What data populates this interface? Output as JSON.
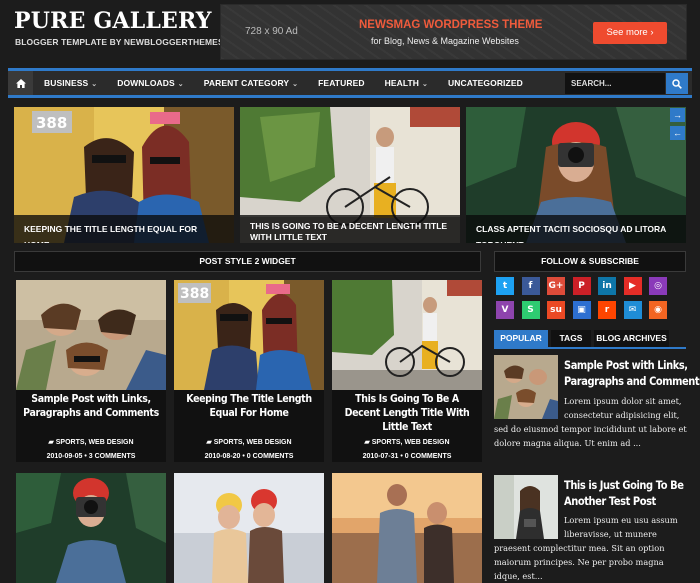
{
  "header": {
    "site_title": "PURE GALLERY",
    "tagline": "BLOGGER TEMPLATE BY NEWBLOGGERTHEMES.COM",
    "ad": {
      "size_label": "728 x 90 Ad",
      "headline": "NEWSMAG WORDPRESS THEME",
      "subline": "for Blog, News & Magazine Websites",
      "button": "See more"
    }
  },
  "nav": {
    "items": [
      {
        "label": "BUSINESS",
        "dropdown": true
      },
      {
        "label": "DOWNLOADS",
        "dropdown": true
      },
      {
        "label": "PARENT CATEGORY",
        "dropdown": true
      },
      {
        "label": "FEATURED",
        "dropdown": false
      },
      {
        "label": "HEALTH",
        "dropdown": true
      },
      {
        "label": "UNCATEGORIZED",
        "dropdown": false
      }
    ],
    "search_placeholder": "SEARCH..."
  },
  "slider": [
    {
      "caption": "KEEPING THE TITLE LENGTH EQUAL FOR HOME"
    },
    {
      "caption": "THIS IS GOING TO BE A DECENT LENGTH TITLE WITH LITTLE TEXT"
    },
    {
      "caption": "CLASS APTENT TACITI SOCIOSQU AD LITORA TORQUENT"
    }
  ],
  "post_widget": {
    "title": "POST STYLE 2 WIDGET",
    "posts": [
      {
        "title": "Sample Post with Links, Paragraphs and Comments",
        "categories": "SPORTS, WEB DESIGN",
        "date": "2010-09-05",
        "comments": "3 COMMENTS"
      },
      {
        "title": "Keeping The Title Length Equal For Home",
        "categories": "SPORTS, WEB DESIGN",
        "date": "2010-08-20",
        "comments": "0 COMMENTS"
      },
      {
        "title": "This Is Going To Be A Decent Length Title With Little Text",
        "categories": "SPORTS, WEB DESIGN",
        "date": "2010-07-31",
        "comments": "0 COMMENTS"
      }
    ]
  },
  "sidebar": {
    "follow_title": "FOLLOW & SUBSCRIBE",
    "social_row1": [
      {
        "icon": "twitter-icon",
        "glyph": "t",
        "color": "#1da1f2"
      },
      {
        "icon": "facebook-icon",
        "glyph": "f",
        "color": "#3b5998"
      },
      {
        "icon": "google-plus-icon",
        "glyph": "G+",
        "color": "#dd4b39"
      },
      {
        "icon": "pinterest-icon",
        "glyph": "P",
        "color": "#cb2027"
      },
      {
        "icon": "linkedin-icon",
        "glyph": "in",
        "color": "#0e76a8"
      },
      {
        "icon": "youtube-icon",
        "glyph": "▶",
        "color": "#e52d27"
      },
      {
        "icon": "instagram-icon",
        "glyph": "◎",
        "color": "#8a3ab9"
      }
    ],
    "social_row2": [
      {
        "icon": "vine-icon",
        "glyph": "V",
        "color": "#8e44ad"
      },
      {
        "icon": "snapchat-icon",
        "glyph": "S",
        "color": "#2ecc71"
      },
      {
        "icon": "stumbleupon-icon",
        "glyph": "su",
        "color": "#eb4924"
      },
      {
        "icon": "delicious-icon",
        "glyph": "▣",
        "color": "#2d6fd1"
      },
      {
        "icon": "reddit-icon",
        "glyph": "r",
        "color": "#ff4500"
      },
      {
        "icon": "email-icon",
        "glyph": "✉",
        "color": "#1f8dd6"
      },
      {
        "icon": "rss-icon",
        "glyph": "◉",
        "color": "#f26522"
      }
    ],
    "tabs": [
      "POPULAR",
      "TAGS",
      "BLOG ARCHIVES"
    ],
    "popular": [
      {
        "title_line1": "Sample Post with Links,",
        "title_line2": "Paragraphs and Comments",
        "excerpt": "Lorem ipsum dolor sit amet, consectetur adipisicing elit, sed do eiusmod tempor incididunt ut labore et dolore magna aliqua. Ut enim ad ..."
      },
      {
        "title_line1": "This is Just Going To Be",
        "title_line2": "Another Test Post",
        "excerpt": "Lorem ipsum eu usu assum liberavisse, ut munere praesent complectitur mea. Sit an option maiorum principes. Ne per probo magna idque, est..."
      }
    ]
  }
}
